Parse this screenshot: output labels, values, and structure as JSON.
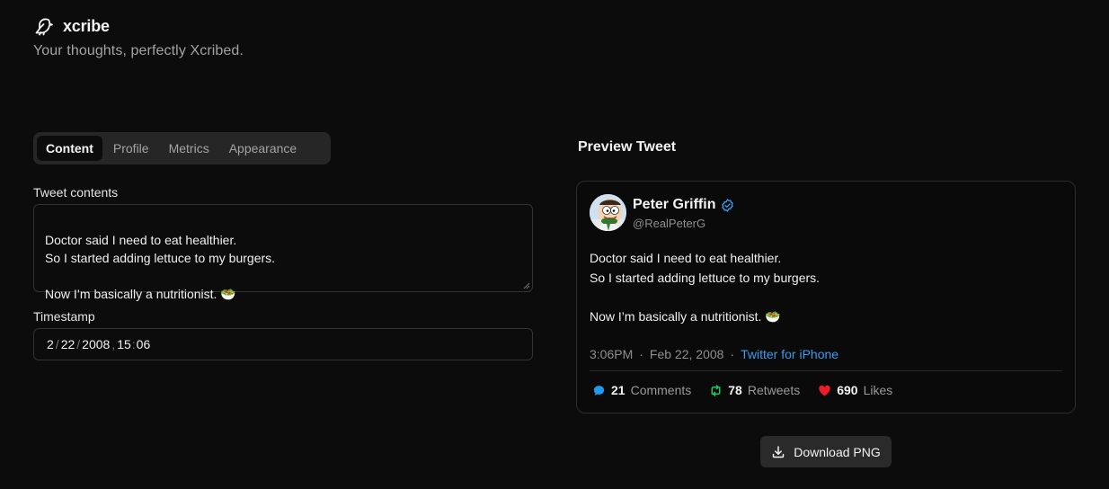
{
  "app": {
    "name": "xcribe",
    "tagline": "Your thoughts, perfectly Xcribed."
  },
  "tabs": [
    {
      "label": "Content",
      "active": true
    },
    {
      "label": "Profile",
      "active": false
    },
    {
      "label": "Metrics",
      "active": false
    },
    {
      "label": "Appearance",
      "active": false
    }
  ],
  "form": {
    "contents_label": "Tweet contents",
    "contents_value": "Doctor said I need to eat healthier.\nSo I started adding lettuce to my burgers.\n\nNow I’m basically a nutritionist. 🥗",
    "timestamp_label": "Timestamp",
    "timestamp_month": "2",
    "timestamp_day": "22",
    "timestamp_year": "2008",
    "timestamp_hour": "15",
    "timestamp_minute": "06"
  },
  "preview": {
    "title": "Preview Tweet",
    "display_name": "Peter Griffin",
    "handle": "@RealPeterG",
    "body": "Doctor said I need to eat healthier.\nSo I started adding lettuce to my burgers.\n\nNow I’m basically a nutritionist. 🥗",
    "time": "3:06PM",
    "date": "Feb 22, 2008",
    "source": "Twitter for iPhone",
    "comments_count": "21",
    "comments_label": "Comments",
    "retweets_count": "78",
    "retweets_label": "Retweets",
    "likes_count": "690",
    "likes_label": "Likes",
    "verified": true
  },
  "actions": {
    "download_label": "Download PNG"
  },
  "colors": {
    "background": "#0c0c0c",
    "link_blue": "#3b9cf0",
    "verified_blue": "#3b9cf0",
    "comment_icon": "#1d9bf0",
    "retweet_icon": "#22c55e",
    "like_icon": "#ef1a2a"
  },
  "icons": {
    "logo": "bird-icon",
    "verified": "verified-badge-icon",
    "comments": "speech-bubble-icon",
    "retweets": "retweet-icon",
    "likes": "heart-icon",
    "download": "download-icon"
  }
}
